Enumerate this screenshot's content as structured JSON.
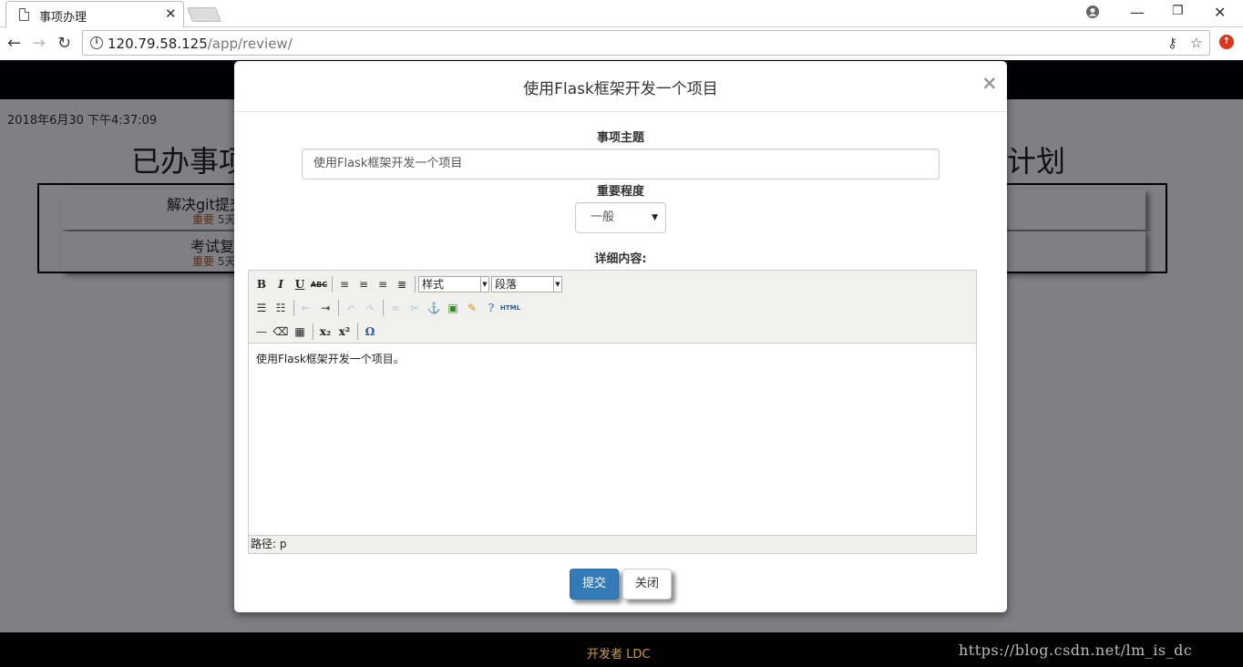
{
  "browser": {
    "tab_title": "事项办理",
    "tab_close": "✕",
    "url_host": "120.79.58.125",
    "url_path": "/app/review/",
    "minimize": "—",
    "restore": "❐",
    "close": "✕"
  },
  "page": {
    "timestamp": "2018年6月30 下午4:37:09",
    "heading_left": "已办事项",
    "heading_right": "计划",
    "items": [
      {
        "title": "解决git提交",
        "importance": "重要",
        "days": "5天"
      },
      {
        "title": "考试复",
        "importance": "重要",
        "days": "5天"
      }
    ],
    "footer": "开发者 LDC",
    "watermark": "https://blog.csdn.net/lm_is_dc"
  },
  "modal": {
    "title": "使用Flask框架开发一个项目",
    "close": "×",
    "topic_label": "事项主题",
    "topic_value": "使用Flask框架开发一个项目",
    "level_label": "重要程度",
    "level_value": "一般",
    "detail_label": "详细内容:",
    "editor": {
      "style_select": "样式",
      "format_select": "段落",
      "content": "使用Flask框架开发一个项目。",
      "status": "路径: p"
    },
    "submit": "提交",
    "cancel": "关闭"
  },
  "colors": {
    "primary": "#337ab7",
    "footer_text": "#c99e4d",
    "importance": "#b35a1f"
  }
}
